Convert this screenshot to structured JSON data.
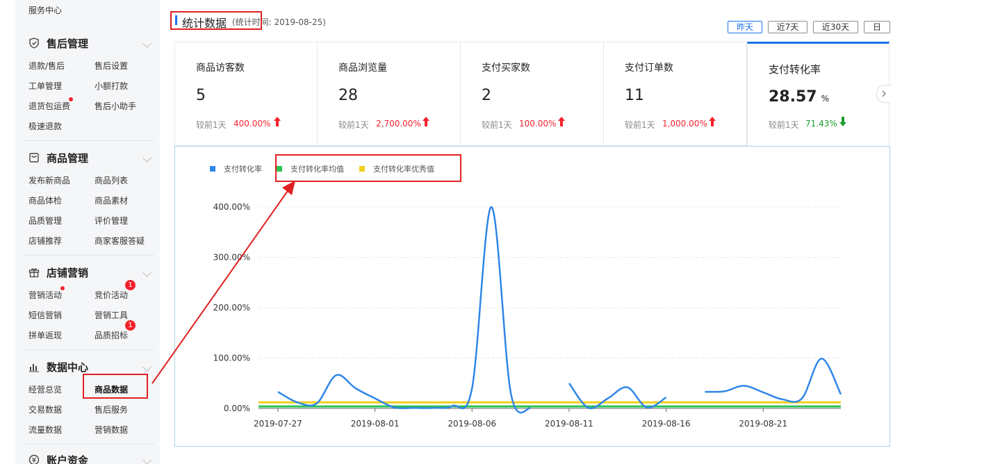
{
  "sidebar": {
    "top_item": "服务中心",
    "sections": [
      {
        "title": "售后管理",
        "icon": "shield-icon",
        "items": [
          "退款/售后",
          "售后设置",
          "工单管理",
          "小额打款",
          "退货包运费",
          "售后小助手",
          "极速退款"
        ]
      },
      {
        "title": "商品管理",
        "icon": "bag-icon",
        "items": [
          "发布新商品",
          "商品列表",
          "商品体检",
          "商品素材",
          "品质管理",
          "评价管理",
          "店铺推荐",
          "商家客服答疑"
        ]
      },
      {
        "title": "店铺营销",
        "icon": "gift-icon",
        "items": [
          "营销活动",
          "竞价活动",
          "短信营销",
          "营销工具",
          "拼单返现",
          "品质招标"
        ],
        "badges": [
          "1",
          "1"
        ]
      },
      {
        "title": "数据中心",
        "icon": "bar-chart-icon",
        "items": [
          "经营总览",
          "商品数据",
          "交易数据",
          "售后服务",
          "流量数据",
          "营销数据"
        ]
      },
      {
        "title": "账户资金",
        "icon": "money-icon",
        "items": []
      }
    ],
    "active_item": "商品数据"
  },
  "header": {
    "title": "统计数据",
    "subtitle": "(统计时间: 2019-08-25)",
    "ranges": [
      "昨天",
      "近7天",
      "近30天",
      "日"
    ],
    "active_range": "昨天"
  },
  "cards": [
    {
      "label": "商品访客数",
      "value": "5",
      "unit": "",
      "compare": "较前1天",
      "pct": "400.00%",
      "trend": "up"
    },
    {
      "label": "商品浏览量",
      "value": "28",
      "unit": "",
      "compare": "较前1天",
      "pct": "2,700.00%",
      "trend": "up"
    },
    {
      "label": "支付买家数",
      "value": "2",
      "unit": "",
      "compare": "较前1天",
      "pct": "100.00%",
      "trend": "up"
    },
    {
      "label": "支付订单数",
      "value": "11",
      "unit": "",
      "compare": "较前1天",
      "pct": "1,000.00%",
      "trend": "up"
    },
    {
      "label": "支付转化率",
      "value": "28.57",
      "unit": "%",
      "compare": "较前1天",
      "pct": "71.43%",
      "trend": "down"
    }
  ],
  "colors": {
    "accent": "#1a73e8",
    "up": "#f5222d",
    "down": "#1a9e2f",
    "series_main": "#2f86e8",
    "series_avg": "#2ac253",
    "series_best": "#f2cf1c",
    "annotation": "#e02020"
  },
  "chart_data": {
    "type": "line",
    "legend": [
      "支付转化率",
      "支付转化率均值",
      "支付转化率优秀值"
    ],
    "x_ticks": [
      "2019-07-27",
      "2019-08-01",
      "2019-08-06",
      "2019-08-11",
      "2019-08-16",
      "2019-08-21"
    ],
    "y_ticks": [
      "0.00%",
      "100.00%",
      "200.00%",
      "300.00%",
      "400.00%"
    ],
    "ylim": [
      0,
      400
    ],
    "x_range": [
      "2019-07-26",
      "2019-08-25"
    ],
    "series": [
      {
        "name": "支付转化率",
        "color": "#2f86e8",
        "segments": [
          [
            [
              "2019-07-27",
              33
            ],
            [
              "2019-07-28",
              12
            ],
            [
              "2019-07-29",
              10
            ],
            [
              "2019-07-30",
              66
            ],
            [
              "2019-07-31",
              40
            ],
            [
              "2019-08-01",
              20
            ],
            [
              "2019-08-02",
              2
            ],
            [
              "2019-08-03",
              1
            ],
            [
              "2019-08-04",
              1
            ],
            [
              "2019-08-05",
              5
            ],
            [
              "2019-08-06",
              40
            ],
            [
              "2019-08-07",
              400
            ],
            [
              "2019-08-08",
              30
            ],
            [
              "2019-08-09",
              0
            ]
          ],
          [
            [
              "2019-08-11",
              50
            ],
            [
              "2019-08-12",
              1
            ],
            [
              "2019-08-13",
              20
            ],
            [
              "2019-08-14",
              42
            ],
            [
              "2019-08-15",
              2
            ],
            [
              "2019-08-16",
              22
            ]
          ],
          [
            [
              "2019-08-18",
              33
            ],
            [
              "2019-08-19",
              34
            ],
            [
              "2019-08-20",
              45
            ],
            [
              "2019-08-21",
              32
            ],
            [
              "2019-08-22",
              18
            ],
            [
              "2019-08-23",
              20
            ],
            [
              "2019-08-24",
              99
            ],
            [
              "2019-08-25",
              28
            ]
          ]
        ]
      },
      {
        "name": "支付转化率均值",
        "color": "#2ac253",
        "constant": 4
      },
      {
        "name": "支付转化率优秀值",
        "color": "#f2cf1c",
        "constant": 12
      }
    ]
  }
}
